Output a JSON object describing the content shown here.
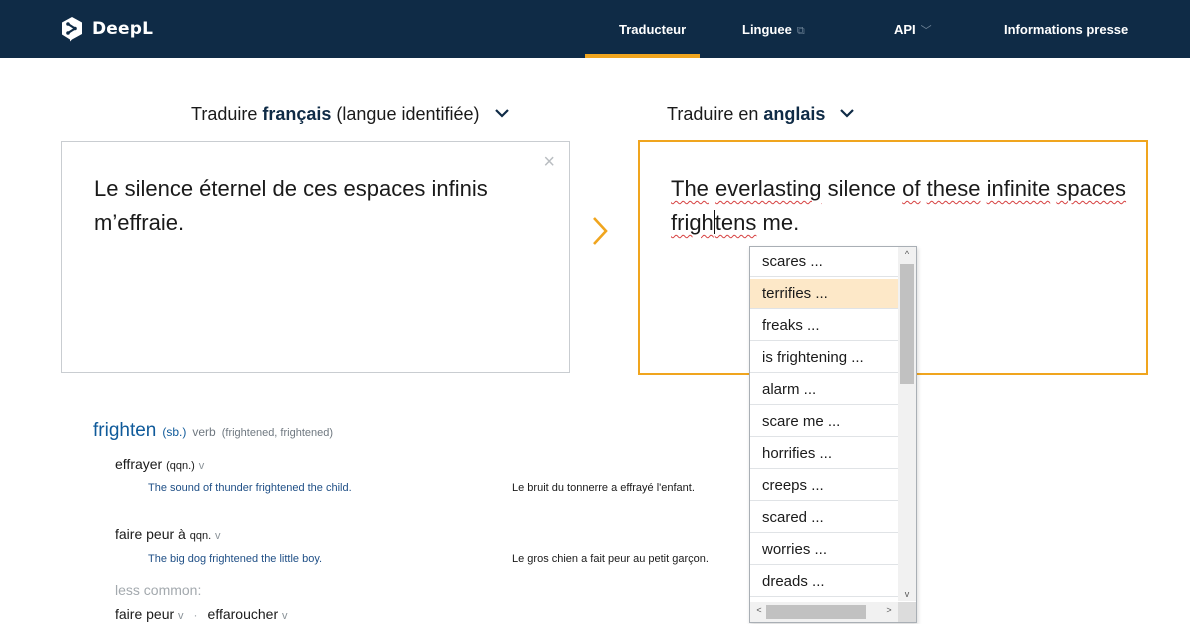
{
  "header": {
    "brand": "DeepL",
    "nav": [
      {
        "label": "Traducteur",
        "icon": ""
      },
      {
        "label": "Linguee",
        "icon": "external-link-icon"
      },
      {
        "label": "API",
        "icon": "chevron-down-icon"
      },
      {
        "label": "Informations presse",
        "icon": ""
      }
    ],
    "active_nav": "Traducteur",
    "colors": {
      "bar": "#0f2b46",
      "accent": "#f0a51e"
    }
  },
  "source": {
    "prefix": "Traduire ",
    "language": "français",
    "suffix": " (langue identifiée)",
    "text": "Le silence éternel de ces espaces infinis m’effraie.",
    "clear_icon": "×"
  },
  "target": {
    "prefix": "Traduire en ",
    "language": "anglais",
    "words": {
      "w1": "The",
      "w2": "everlasting",
      "w3": "silence",
      "w4": "of",
      "w5": "these",
      "w6": "infinite",
      "w7": "spaces",
      "w8a": "frigh",
      "w8b": "tens",
      "w9": "me."
    }
  },
  "alternatives": {
    "items": [
      "scares ...",
      "terrifies ...",
      "freaks ...",
      "is frightening ...",
      "alarm ...",
      "scare me ...",
      "horrifies ...",
      "creeps ...",
      "scared ...",
      "worries ...",
      "dreads ..."
    ],
    "highlighted_index": 1,
    "scroll": {
      "up": "^",
      "down": "v",
      "left": "<",
      "right": ">"
    }
  },
  "dictionary": {
    "headword": "frighten",
    "headword_note": "(sb.)",
    "pos": "verb",
    "forms": "(frightened, frightened)",
    "entries": [
      {
        "translation": "effrayer",
        "note": "(qqn.)",
        "pos": "v",
        "example_src": "The sound of thunder frightened the child.",
        "example_tgt": "Le bruit du tonnerre a effrayé l'enfant."
      },
      {
        "translation": "faire peur à",
        "note": "qqn.",
        "pos": "v",
        "example_src": "The big dog frightened the little boy.",
        "example_tgt": "Le gros chien a fait peur au petit garçon."
      }
    ],
    "less_common_label": "less common:",
    "less_common": [
      {
        "translation": "faire peur",
        "pos": "v"
      },
      {
        "translation": "effaroucher",
        "pos": "v"
      }
    ],
    "separator": "·"
  }
}
